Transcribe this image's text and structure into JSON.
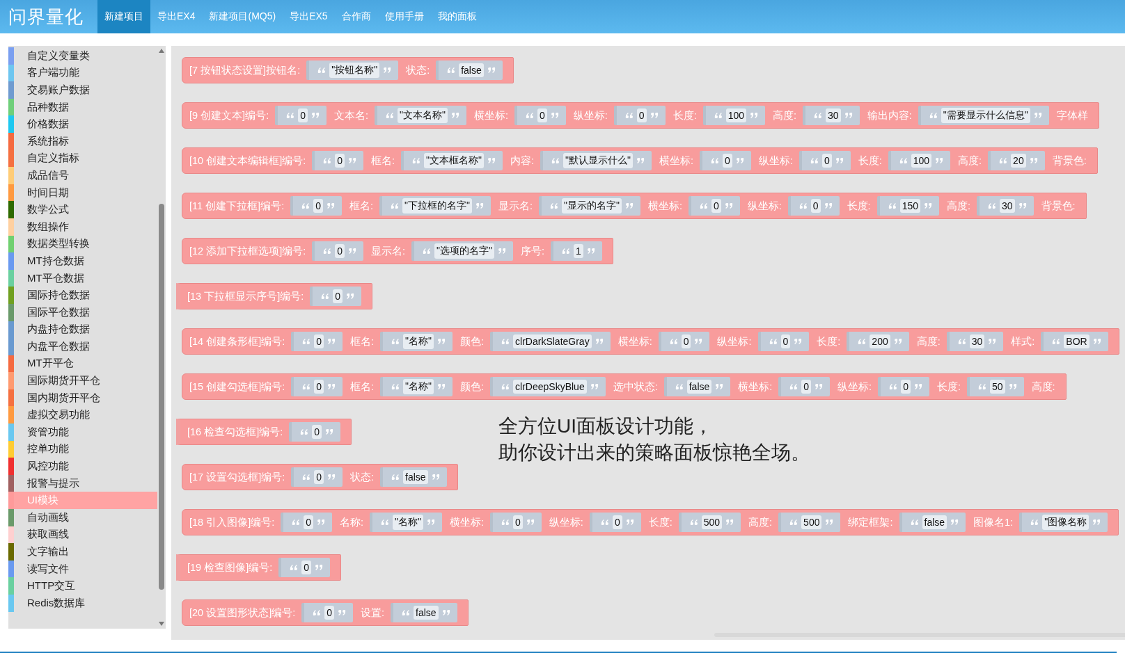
{
  "header": {
    "logo": "问界量化",
    "tabs": [
      {
        "label": "新建项目",
        "selected": true
      },
      {
        "label": "导出EX4",
        "selected": false
      },
      {
        "label": "新建项目(MQ5)",
        "selected": false
      },
      {
        "label": "导出EX5",
        "selected": false
      },
      {
        "label": "合作商",
        "selected": false
      },
      {
        "label": "使用手册",
        "selected": false
      },
      {
        "label": "我的面板",
        "selected": false
      }
    ]
  },
  "sidebar": {
    "items": [
      {
        "label": "自定义变量类",
        "color": "#7a9ff0",
        "selected": false
      },
      {
        "label": "客户端功能",
        "color": "#6ec6f0",
        "selected": false
      },
      {
        "label": "交易账户数据",
        "color": "#6f9bd0",
        "selected": false
      },
      {
        "label": "品种数据",
        "color": "#6fcf7a",
        "selected": false
      },
      {
        "label": "价格数据",
        "color": "#1ec8f0",
        "selected": false
      },
      {
        "label": "系统指标",
        "color": "#f56a40",
        "selected": false
      },
      {
        "label": "自定义指标",
        "color": "#f57040",
        "selected": false
      },
      {
        "label": "成品信号",
        "color": "#ffcc77",
        "selected": false
      },
      {
        "label": "时间日期",
        "color": "#ff9a40",
        "selected": false
      },
      {
        "label": "数学公式",
        "color": "#2e6a00",
        "selected": false
      },
      {
        "label": "数组操作",
        "color": "#ffd0a0",
        "selected": false
      },
      {
        "label": "数据类型转换",
        "color": "#70d070",
        "selected": false
      },
      {
        "label": "MT持仓数据",
        "color": "#6a9af0",
        "selected": false
      },
      {
        "label": "MT平仓数据",
        "color": "#6ad0a0",
        "selected": false
      },
      {
        "label": "国际持仓数据",
        "color": "#70a020",
        "selected": false
      },
      {
        "label": "国际平仓数据",
        "color": "#6a9a6a",
        "selected": false
      },
      {
        "label": "内盘持仓数据",
        "color": "#6a9ad0",
        "selected": false
      },
      {
        "label": "内盘平仓数据",
        "color": "#6a9ad0",
        "selected": false
      },
      {
        "label": "MT开平仓",
        "color": "#f56a40",
        "selected": false
      },
      {
        "label": "国际期货开平仓",
        "color": "#ff9a70",
        "selected": false
      },
      {
        "label": "国内期货开平仓",
        "color": "#f57040",
        "selected": false
      },
      {
        "label": "虚拟交易功能",
        "color": "#ff9a40",
        "selected": false
      },
      {
        "label": "资管功能",
        "color": "#6ac8f0",
        "selected": false
      },
      {
        "label": "控单功能",
        "color": "#ffcc33",
        "selected": false
      },
      {
        "label": "风控功能",
        "color": "#f03030",
        "selected": false
      },
      {
        "label": "报警与提示",
        "color": "#a06060",
        "selected": false
      },
      {
        "label": "UI模块",
        "color": "#ff9a9a",
        "selected": true
      },
      {
        "label": "自动画线",
        "color": "#6a9a6a",
        "selected": false
      },
      {
        "label": "获取画线",
        "color": "#ffd0d0",
        "selected": false
      },
      {
        "label": "文字输出",
        "color": "#6a6a00",
        "selected": false
      },
      {
        "label": "读写文件",
        "color": "#6a9af0",
        "selected": false
      },
      {
        "label": "HTTP交互",
        "color": "#6ad0a0",
        "selected": false
      },
      {
        "label": "Redis数据库",
        "color": "#6ac8f0",
        "selected": false
      }
    ]
  },
  "workspace": {
    "blocks": [
      {
        "kind": "statement",
        "title": "[7 按钮状态设置]按钮名:",
        "inputs": [
          {
            "value": "\"按钮名称\""
          },
          {
            "label": "状态:",
            "value": "false"
          }
        ]
      },
      {
        "kind": "statement",
        "title": "[9 创建文本]编号:",
        "inputs": [
          {
            "value": "0"
          },
          {
            "label": "文本名:",
            "value": "\"文本名称\""
          },
          {
            "label": "横坐标:",
            "value": "0"
          },
          {
            "label": "纵坐标:",
            "value": "0"
          },
          {
            "label": "长度:",
            "value": "100"
          },
          {
            "label": "高度:",
            "value": "30"
          },
          {
            "label": "输出内容:",
            "value": "\"需要显示什么信息\""
          },
          {
            "label": "字体样"
          }
        ]
      },
      {
        "kind": "statement",
        "title": "[10 创建文本编辑框]编号:",
        "inputs": [
          {
            "value": "0"
          },
          {
            "label": "框名:",
            "value": "\"文本框名称\""
          },
          {
            "label": "内容:",
            "value": "\"默认显示什么\""
          },
          {
            "label": "横坐标:",
            "value": "0"
          },
          {
            "label": "纵坐标:",
            "value": "0"
          },
          {
            "label": "长度:",
            "value": "100"
          },
          {
            "label": "高度:",
            "value": "20"
          },
          {
            "label": "背景色:"
          }
        ]
      },
      {
        "kind": "statement",
        "title": "[11 创建下拉框]编号:",
        "inputs": [
          {
            "value": "0"
          },
          {
            "label": "框名:",
            "value": "\"下拉框的名字\""
          },
          {
            "label": "显示名:",
            "value": "\"显示的名字\""
          },
          {
            "label": "横坐标:",
            "value": "0"
          },
          {
            "label": "纵坐标:",
            "value": "0"
          },
          {
            "label": "长度:",
            "value": "150"
          },
          {
            "label": "高度:",
            "value": "30"
          },
          {
            "label": "背景色:"
          }
        ]
      },
      {
        "kind": "statement",
        "title": "[12 添加下拉框选项]编号:",
        "inputs": [
          {
            "value": "0"
          },
          {
            "label": "显示名:",
            "value": "\"选项的名字\""
          },
          {
            "label": "序号:",
            "value": "1"
          }
        ]
      },
      {
        "kind": "value",
        "title": "[13 下拉框显示序号]编号:",
        "inputs": [
          {
            "value": "0"
          }
        ]
      },
      {
        "kind": "statement",
        "title": "[14 创建条形框]编号:",
        "inputs": [
          {
            "value": "0"
          },
          {
            "label": "框名:",
            "value": "\"名称\""
          },
          {
            "label": "颜色:",
            "value": "clrDarkSlateGray"
          },
          {
            "label": "横坐标:",
            "value": "0"
          },
          {
            "label": "纵坐标:",
            "value": "0"
          },
          {
            "label": "长度:",
            "value": "200"
          },
          {
            "label": "高度:",
            "value": "30"
          },
          {
            "label": "样式:",
            "value": "BOR"
          }
        ]
      },
      {
        "kind": "statement",
        "title": "[15 创建勾选框]编号:",
        "inputs": [
          {
            "value": "0"
          },
          {
            "label": "框名:",
            "value": "\"名称\""
          },
          {
            "label": "颜色:",
            "value": "clrDeepSkyBlue"
          },
          {
            "label": "选中状态:",
            "value": "false"
          },
          {
            "label": "横坐标:",
            "value": "0"
          },
          {
            "label": "纵坐标:",
            "value": "0"
          },
          {
            "label": "长度:",
            "value": "50"
          },
          {
            "label": "高度:"
          }
        ]
      },
      {
        "kind": "value",
        "title": "[16 检查勾选框]编号:",
        "inputs": [
          {
            "value": "0"
          }
        ]
      },
      {
        "kind": "statement",
        "title": "[17 设置勾选框]编号:",
        "inputs": [
          {
            "value": "0"
          },
          {
            "label": "状态:",
            "value": "false"
          }
        ]
      },
      {
        "kind": "statement",
        "title": "[18 引入图像]编号:",
        "inputs": [
          {
            "value": "0"
          },
          {
            "label": "名称:",
            "value": "\"名称\""
          },
          {
            "label": "横坐标:",
            "value": "0"
          },
          {
            "label": "纵坐标:",
            "value": "0"
          },
          {
            "label": "长度:",
            "value": "500"
          },
          {
            "label": "高度:",
            "value": "500"
          },
          {
            "label": "绑定框架:",
            "value": "false"
          },
          {
            "label": "图像名1:",
            "value": "\"图像名称"
          }
        ]
      },
      {
        "kind": "value",
        "title": "[19 检查图像]编号:",
        "inputs": [
          {
            "value": "0"
          }
        ]
      },
      {
        "kind": "statement",
        "title": "[20 设置图形状态]编号:",
        "inputs": [
          {
            "value": "0"
          },
          {
            "label": "设置:",
            "value": "false"
          }
        ]
      }
    ],
    "caption": [
      "全方位UI面板设计功能，",
      "助你设计出来的策略面板惊艳全场。"
    ]
  }
}
